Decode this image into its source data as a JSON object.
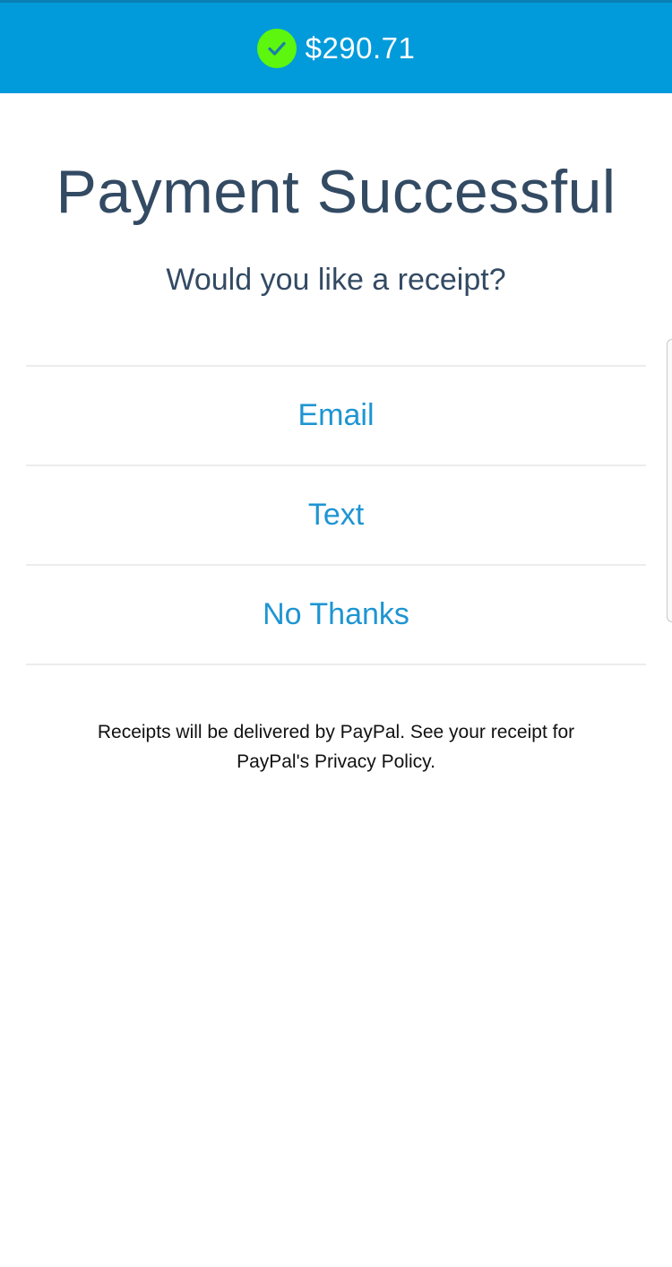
{
  "header": {
    "amount": "$290.71",
    "status_icon": "check-circle-icon",
    "background_color": "#019bdb",
    "check_color": "#5cf60e"
  },
  "main": {
    "title": "Payment Successful",
    "subtitle": "Would you like a receipt?",
    "options": [
      {
        "label": "Email"
      },
      {
        "label": "Text"
      },
      {
        "label": "No Thanks"
      }
    ],
    "disclaimer": "Receipts will be delivered by PayPal. See your receipt for PayPal's Privacy Policy."
  },
  "colors": {
    "title_text": "#334a63",
    "option_text": "#1e95d2",
    "divider": "#ececec"
  }
}
